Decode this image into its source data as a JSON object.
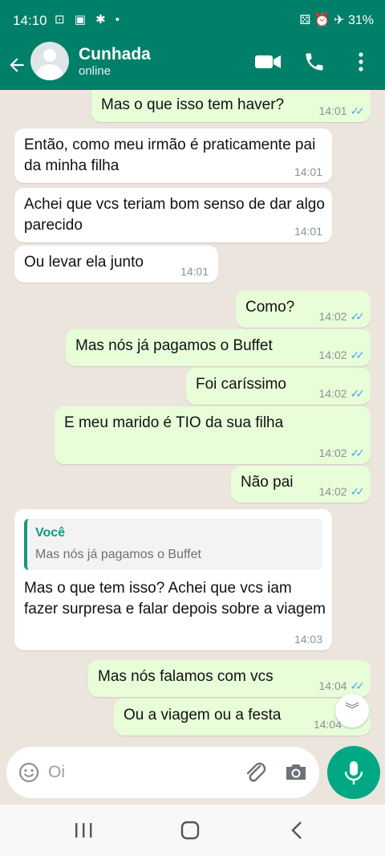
{
  "status_bar": {
    "time": "14:10",
    "left_icons": "⊡ ▣ ✱ •",
    "right_text": "⚄ ⏰ ✈ 31%"
  },
  "header": {
    "contact_name": "Cunhada",
    "contact_status": "online"
  },
  "messages": [
    {
      "dir": "out",
      "text": "Mas o que isso tem haver?",
      "time": "14:01"
    },
    {
      "dir": "in",
      "text": "Então, como meu irmão é praticamente pai da minha filha",
      "time": "14:01"
    },
    {
      "dir": "in",
      "text": "Achei que vcs teriam bom senso de dar algo parecido",
      "time": "14:01"
    },
    {
      "dir": "in",
      "text": "Ou levar ela junto",
      "time": "14:01"
    },
    {
      "dir": "out",
      "text": "Como?",
      "time": "14:02"
    },
    {
      "dir": "out",
      "text": "Mas nós já pagamos o Buffet",
      "time": "14:02"
    },
    {
      "dir": "out",
      "text": "Foi caríssimo",
      "time": "14:02"
    },
    {
      "dir": "out",
      "text": "E meu marido é TIO da sua filha",
      "time": "14:02"
    },
    {
      "dir": "out",
      "text": "Não pai",
      "time": "14:02"
    },
    {
      "dir": "in",
      "text": "Mas o que tem isso? Achei que vcs iam fazer surpresa e falar depois sobre a viagem",
      "time": "14:03",
      "quote": {
        "author": "Você",
        "text": "Mas nós já pagamos o Buffet"
      }
    },
    {
      "dir": "out",
      "text": "Mas nós falamos com vcs",
      "time": "14:04"
    },
    {
      "dir": "out",
      "text": "Ou a viagem ou a festa",
      "time": "14:04"
    }
  ],
  "composer": {
    "placeholder": "Oi"
  },
  "colors": {
    "header": "#008069",
    "outgoing_bubble": "#e7fed9",
    "incoming_bubble": "#ffffff",
    "read_ticks": "#4fa6e6",
    "mic_button": "#00a884"
  }
}
